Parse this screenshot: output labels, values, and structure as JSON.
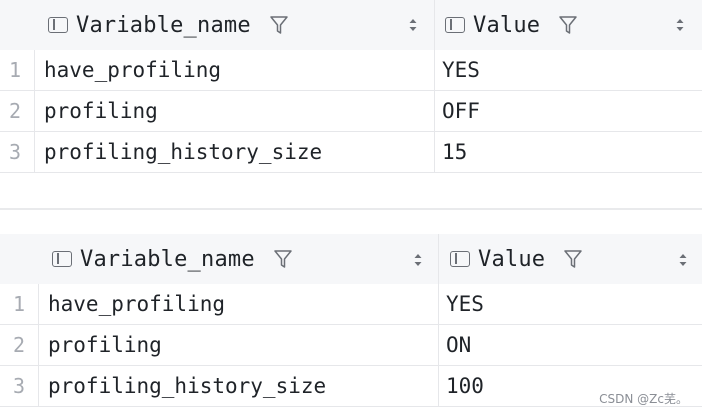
{
  "tables": [
    {
      "columns": [
        {
          "label": "Variable_name"
        },
        {
          "label": "Value"
        }
      ],
      "rows": [
        {
          "num": "1",
          "name": "have_profiling",
          "value": "YES"
        },
        {
          "num": "2",
          "name": "profiling",
          "value": "OFF"
        },
        {
          "num": "3",
          "name": "profiling_history_size",
          "value": "15"
        }
      ]
    },
    {
      "columns": [
        {
          "label": "Variable_name"
        },
        {
          "label": "Value"
        }
      ],
      "rows": [
        {
          "num": "1",
          "name": "have_profiling",
          "value": "YES"
        },
        {
          "num": "2",
          "name": "profiling",
          "value": "ON"
        },
        {
          "num": "3",
          "name": "profiling_history_size",
          "value": "100"
        }
      ]
    }
  ],
  "watermark": "CSDN @Zc芜。"
}
